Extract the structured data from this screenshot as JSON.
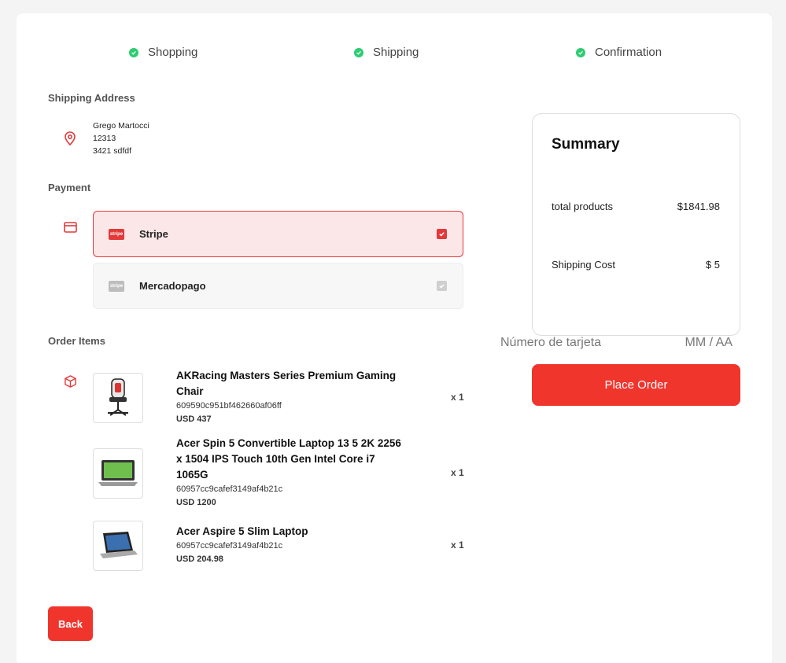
{
  "steps": [
    {
      "label": "Shopping",
      "status": "complete"
    },
    {
      "label": "Shipping",
      "status": "complete"
    },
    {
      "label": "Confirmation",
      "status": "complete"
    }
  ],
  "shipping": {
    "title": "Shipping Address",
    "icon": "location-pin-icon",
    "name": "Grego Martocci",
    "line1": "12313",
    "line2": "3421 sdfdf"
  },
  "payment": {
    "title": "Payment",
    "icon": "credit-card-icon",
    "options": [
      {
        "label": "Stripe",
        "logo_text": "stripe",
        "selected": true
      },
      {
        "label": "Mercadopago",
        "logo_text": "stripe",
        "selected": false
      }
    ]
  },
  "order_items": {
    "title": "Order Items",
    "icon": "box-icon",
    "items": [
      {
        "name": "AKRacing Masters Series Premium Gaming Chair",
        "id": "609590c951bf462660af06ff",
        "price": "USD 437",
        "qty": "x 1",
        "thumb": "gaming-chair"
      },
      {
        "name": "Acer Spin 5 Convertible Laptop 13 5 2K 2256 x 1504 IPS Touch 10th Gen Intel Core i7 1065G",
        "id": "60957cc9cafef3149af4b21c",
        "price": "USD 1200",
        "qty": "x 1",
        "thumb": "laptop"
      },
      {
        "name": "Acer Aspire 5 Slim Laptop",
        "id": "60957cc9cafef3149af4b21c",
        "price": "USD 204.98",
        "qty": "x 1",
        "thumb": "laptop"
      }
    ]
  },
  "summary": {
    "title": "Summary",
    "total_products_label": "total products",
    "total_products_value": "$1841.98",
    "shipping_label": "Shipping Cost",
    "shipping_value": "$ 5"
  },
  "card": {
    "number_placeholder": "Número de tarjeta",
    "expiry_placeholder": "MM / AA"
  },
  "buttons": {
    "place_order": "Place Order",
    "back": "Back"
  },
  "colors": {
    "accent": "#f0352d",
    "success": "#2ecc71",
    "selected_bg": "#fbe7e7"
  }
}
